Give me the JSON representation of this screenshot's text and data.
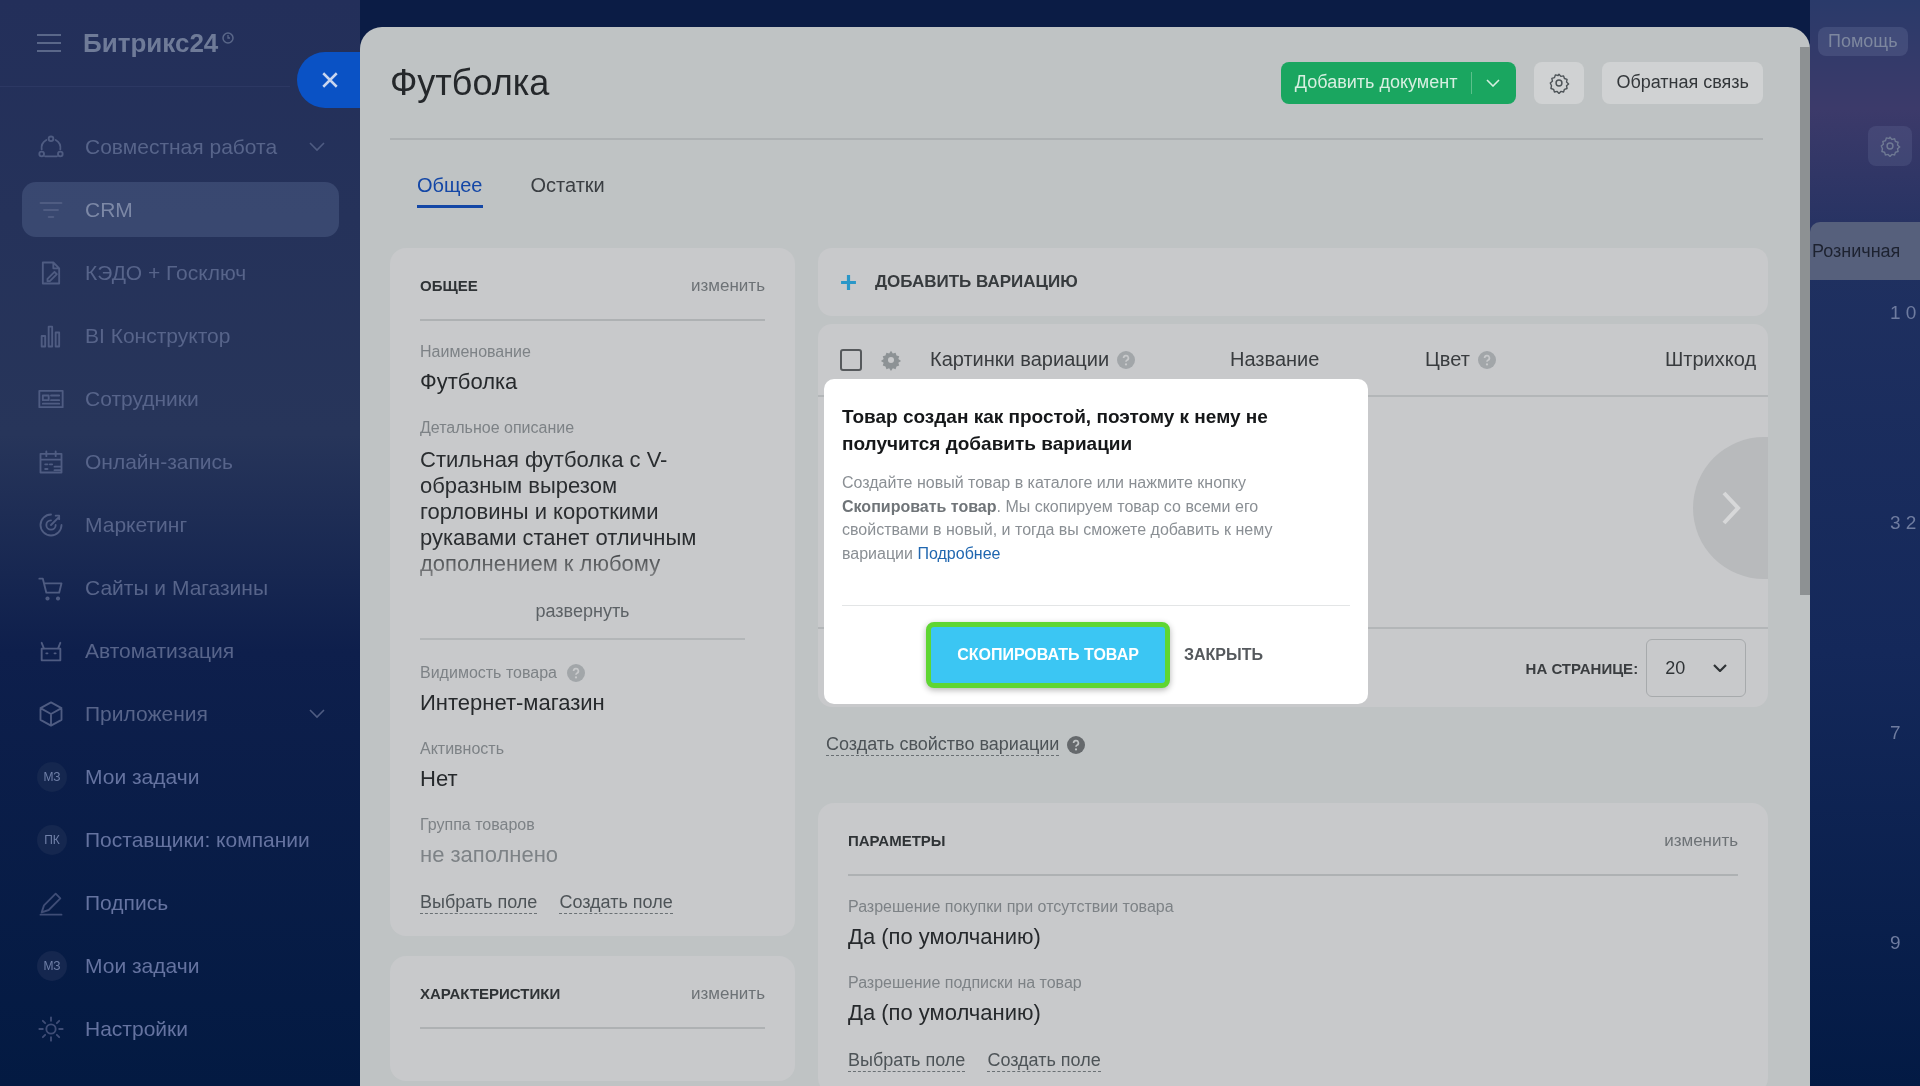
{
  "sidebar": {
    "logo": "Битрикс24",
    "items": [
      {
        "label": "Совместная работа",
        "kind": "icon",
        "expandable": true,
        "selected": false
      },
      {
        "label": "CRM",
        "kind": "icon",
        "expandable": false,
        "selected": true
      },
      {
        "label": "КЭДО + Госключ",
        "kind": "icon",
        "expandable": false,
        "selected": false
      },
      {
        "label": "BI Конструктор",
        "kind": "icon",
        "expandable": false,
        "selected": false
      },
      {
        "label": "Сотрудники",
        "kind": "icon",
        "expandable": false,
        "selected": false
      },
      {
        "label": "Онлайн-запись",
        "kind": "icon",
        "expandable": false,
        "selected": false
      },
      {
        "label": "Маркетинг",
        "kind": "icon",
        "expandable": false,
        "selected": false
      },
      {
        "label": "Сайты и Магазины",
        "kind": "icon",
        "expandable": false,
        "selected": false
      },
      {
        "label": "Автоматизация",
        "kind": "icon",
        "expandable": false,
        "selected": false
      },
      {
        "label": "Приложения",
        "kind": "icon",
        "expandable": true,
        "selected": false
      },
      {
        "label": "Мои задачи",
        "kind": "avatar",
        "initials": "МЗ",
        "expandable": false,
        "selected": false
      },
      {
        "label": "Поставщики: компании",
        "kind": "avatar",
        "initials": "ПК",
        "expandable": false,
        "selected": false
      },
      {
        "label": "Подпись",
        "kind": "icon",
        "expandable": false,
        "selected": false
      },
      {
        "label": "Мои задачи",
        "kind": "avatar",
        "initials": "МЗ",
        "expandable": false,
        "selected": false
      },
      {
        "label": "Настройки",
        "kind": "icon",
        "expandable": false,
        "selected": false
      }
    ]
  },
  "page": {
    "title": "Футболка",
    "add_document": "Добавить документ",
    "feedback": "Обратная связь"
  },
  "tabs": [
    {
      "label": "Общее",
      "selected": true
    },
    {
      "label": "Остатки",
      "selected": false
    }
  ],
  "general_card": {
    "heading": "ОБЩЕЕ",
    "edit": "изменить",
    "fields": [
      {
        "label": "Наименование",
        "value": "Футболка",
        "kind": "text",
        "help": false,
        "empty": false
      },
      {
        "label": "Детальное описание",
        "value": "Стильная футболка с V-образным вырезом горловины и короткими рукавами станет отличным дополнением к любому",
        "kind": "description",
        "expand": "развернуть",
        "help": false,
        "empty": false
      },
      {
        "label": "Видимость товара",
        "value": "Интернет-магазин",
        "kind": "text",
        "help": true,
        "empty": false
      },
      {
        "label": "Активность",
        "value": "Нет",
        "kind": "text",
        "help": false,
        "empty": false
      },
      {
        "label": "Группа товаров",
        "value": "не заполнено",
        "kind": "text",
        "help": false,
        "empty": true
      }
    ],
    "links": [
      "Выбрать поле",
      "Создать поле"
    ]
  },
  "characteristics_card": {
    "heading": "ХАРАКТЕРИСТИКИ",
    "edit": "изменить"
  },
  "variations": {
    "add": "ДОБАВИТЬ ВАРИАЦИЮ",
    "select_all": {
      "checked": false
    },
    "columns": [
      {
        "label": "Картинки вариации",
        "help": true
      },
      {
        "label": "Название",
        "help": false
      },
      {
        "label": "Цвет",
        "help": true
      },
      {
        "label": "Штрихкод",
        "help": false
      }
    ],
    "per_page_label": "НА СТРАНИЦЕ:",
    "per_page": "20",
    "create_property": "Создать свойство вариации"
  },
  "popup": {
    "title": "Товар создан как простой, поэтому к нему не получится добавить вариации",
    "text": "Создайте новый товар в каталоге или нажмите кнопку **Скопировать товар**. Мы скопируем товар со всеми его свойствами в новый, и тогда вы сможете добавить к нему вариации",
    "link": "Подробнее",
    "copy_button": "СКОПИРОВАТЬ ТОВАР",
    "close_button": "ЗАКРЫТЬ"
  },
  "parameters_card": {
    "heading": "ПАРАМЕТРЫ",
    "edit": "изменить",
    "fields": [
      {
        "label": "Разрешение покупки при отсутствии товара",
        "value": "Да (по умолчанию)"
      },
      {
        "label": "Разрешение подписки на товар",
        "value": "Да (по умолчанию)"
      }
    ],
    "links": [
      "Выбрать поле",
      "Создать поле"
    ]
  },
  "background": {
    "help": "Помощь",
    "column": "Розничная",
    "values": [
      "1 0",
      "3 2",
      "7",
      "9"
    ]
  }
}
